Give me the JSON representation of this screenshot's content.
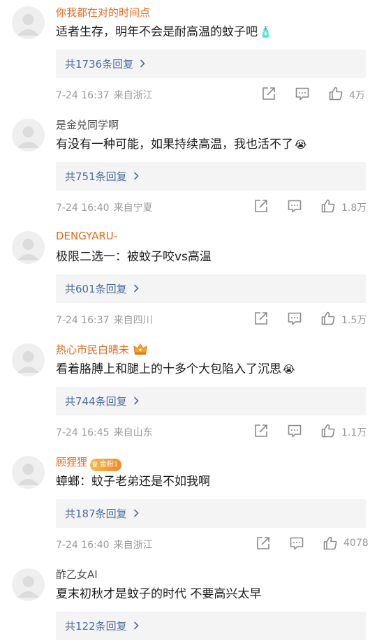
{
  "comments": [
    {
      "username": "你我都在对的时间点",
      "text": "适者生存，明年不会是耐高温的蚊子吧",
      "emoji": "🧴",
      "replies": "共1736条回复",
      "time": "7-24 16:37",
      "location": "来自浙江",
      "likes": "4万"
    },
    {
      "username": "是金兑同学啊",
      "text": "有没有一种可能，如果持续高温，我也活不了",
      "emoji": "😭",
      "replies": "共751条回复",
      "time": "7-24 16:40",
      "location": "来自宁夏",
      "likes": "1.8万"
    },
    {
      "username": "DENGYARU-",
      "text": "极限二选一：被蚊子咬vs高温",
      "replies": "共601条回复",
      "time": "7-24 16:37",
      "location": "来自四川",
      "likes": "1.5万"
    },
    {
      "username": "热心市民白晴未",
      "text": "看着胳膊上和腿上的十多个大包陷入了沉思",
      "emoji": "😭",
      "replies": "共744条回复",
      "time": "7-24 16:45",
      "location": "来自山东",
      "likes": "1.1万"
    },
    {
      "username": "顾狸狸",
      "fan_badge": "金粉1",
      "text": "蟑螂：蚊子老弟还是不如我啊",
      "replies": "共187条回复",
      "time": "7-24 16:40",
      "location": "来自浙江",
      "likes": "4078"
    },
    {
      "username": "酢乙女AI",
      "text": "夏末初秋才是蚊子的时代 不要高兴太早",
      "replies": "共122条回复"
    }
  ],
  "icons": {
    "share": "share-icon",
    "comment": "comment-icon",
    "like": "thumbs-up-icon",
    "reply_chevron": "chevron-right-icon",
    "vip_crown": "crown-badge-icon"
  },
  "colors": {
    "username_orange": "#e8691b",
    "username_gray": "#4d4d4d",
    "reply_link": "#4a6ea2",
    "meta_gray": "#999999",
    "reply_bg": "#f4f4f4"
  }
}
